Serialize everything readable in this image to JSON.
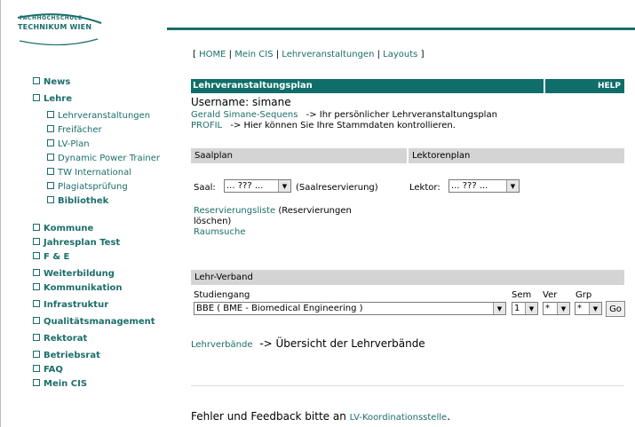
{
  "logo": {
    "top": "FACHHOCHSCHULE",
    "main": "TECHNIKUM WIEN"
  },
  "sidebar": {
    "items": [
      {
        "label": "News"
      },
      {
        "label": "Lehre"
      },
      {
        "label": "Kommune"
      },
      {
        "label": "Jahresplan Test"
      },
      {
        "label": "F & E"
      },
      {
        "label": "Weiterbildung"
      },
      {
        "label": "Kommunikation"
      },
      {
        "label": "Infrastruktur"
      },
      {
        "label": "Qualitätsmanagement"
      },
      {
        "label": "Rektorat"
      },
      {
        "label": "Betriebsrat"
      },
      {
        "label": "FAQ"
      },
      {
        "label": "Mein CIS"
      }
    ],
    "lehre_sub": [
      {
        "label": "Lehrveranstaltungen"
      },
      {
        "label": "Freifächer"
      },
      {
        "label": "LV-Plan"
      },
      {
        "label": "Dynamic Power Trainer"
      },
      {
        "label": "TW International"
      },
      {
        "label": "Plagiatsprüfung"
      },
      {
        "label": "Bibliothek"
      }
    ]
  },
  "topnav": {
    "open": "[",
    "close": "]",
    "sep": "|",
    "home": "HOME",
    "mein_cis": "Mein CIS",
    "lv": "Lehrveranstaltungen",
    "layouts": "Layouts"
  },
  "header": {
    "title": "Lehrveranstaltungsplan",
    "help": "HELP"
  },
  "user": {
    "username_label": "Username: simane",
    "plan_link": "Gerald Simane-Sequens",
    "plan_text": "-> Ihr persönlicher Lehrveranstaltungsplan",
    "profil_link": "PROFIL",
    "profil_text": "-> Hier können Sie Ihre Stammdaten kontrollieren."
  },
  "saalplan": {
    "title": "Saalplan",
    "saal_label": "Saal:",
    "saal_value": "... ??? ...",
    "saal_note": "(Saalreservierung)",
    "reservierung_link": "Reservierungsliste",
    "reservierung_text": "(Reservierungen",
    "reservierung_text2": "löschen)",
    "raumsuche": "Raumsuche"
  },
  "lektorenplan": {
    "title": "Lektorenplan",
    "lektor_label": "Lektor:",
    "lektor_value": "... ??? ..."
  },
  "lehrverband": {
    "title": "Lehr-Verband",
    "studiengang_label": "Studiengang",
    "sem_label": "Sem",
    "ver_label": "Ver",
    "grp_label": "Grp",
    "studiengang_value": "BBE ( BME - Biomedical Engineering )",
    "sem_value": "1",
    "ver_value": "*",
    "grp_value": "*",
    "go": "Go",
    "lv_link": "Lehrverbände",
    "lv_text": "-> Übersicht der Lehrverbände"
  },
  "footer": {
    "text": "Fehler und Feedback bitte an",
    "link": "LV-Koordinationsstelle",
    "end": "."
  },
  "icons": {
    "dropdown": "triangle-down-icon",
    "bullet": "square-bullet-icon"
  },
  "colors": {
    "accent": "#1b6e6a",
    "header": "#0f6e6a",
    "bar": "#d4d4d4"
  }
}
